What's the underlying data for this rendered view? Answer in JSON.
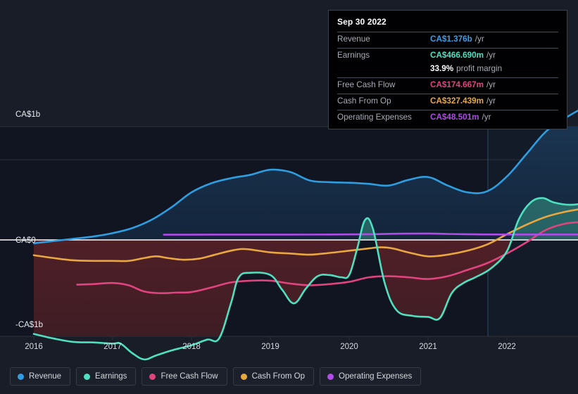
{
  "tooltip": {
    "date": "Sep 30 2022",
    "rows": [
      {
        "key": "Revenue",
        "value": "CA$1.376b",
        "unit": "/yr",
        "color": "#3aa0e8"
      },
      {
        "key": "Earnings",
        "value": "CA$466.690m",
        "unit": "/yr",
        "color": "#4fe0c0"
      },
      {
        "key": "Free Cash Flow",
        "value": "CA$174.667m",
        "unit": "/yr",
        "color": "#e0447f"
      },
      {
        "key": "Cash From Op",
        "value": "CA$327.439m",
        "unit": "/yr",
        "color": "#e9a83f"
      },
      {
        "key": "Operating Expenses",
        "value": "CA$48.501m",
        "unit": "/yr",
        "color": "#b04ae8"
      }
    ],
    "profit_margin_value": "33.9%",
    "profit_margin_label": "profit margin"
  },
  "legend": [
    {
      "label": "Revenue",
      "color": "#2f9ee0"
    },
    {
      "label": "Earnings",
      "color": "#4fe0c0"
    },
    {
      "label": "Free Cash Flow",
      "color": "#e0447f"
    },
    {
      "label": "Cash From Op",
      "color": "#e9a83f"
    },
    {
      "label": "Operating Expenses",
      "color": "#b04ae8"
    }
  ],
  "axes": {
    "y_labels": [
      "CA$1b",
      "CA$0",
      "-CA$1b"
    ],
    "x_labels": [
      "2016",
      "2017",
      "2018",
      "2019",
      "2020",
      "2021",
      "2022"
    ]
  },
  "chart_data": {
    "type": "area",
    "title": "",
    "xlabel": "",
    "ylabel": "CA$",
    "ylim": [
      -1250000000,
      1250000000
    ],
    "y_tick_values": [
      1000000000,
      0,
      -1000000000
    ],
    "y_tick_labels": [
      "CA$1b",
      "CA$0",
      "-CA$1b"
    ],
    "x_tick_labels": [
      "2016",
      "2017",
      "2018",
      "2019",
      "2020",
      "2021",
      "2022"
    ],
    "grid": true,
    "legend_position": "bottom-left",
    "currency": "CA$",
    "forecast_boundary_x_label": "late 2021",
    "series": [
      {
        "name": "Revenue",
        "color": "#2f9ee0",
        "points": [
          [
            2016.0,
            -0.03
          ],
          [
            2016.25,
            -0.01
          ],
          [
            2016.5,
            0.01
          ],
          [
            2016.75,
            0.03
          ],
          [
            2017.0,
            0.06
          ],
          [
            2017.25,
            0.105
          ],
          [
            2017.5,
            0.18
          ],
          [
            2017.75,
            0.29
          ],
          [
            2018.0,
            0.42
          ],
          [
            2018.25,
            0.5
          ],
          [
            2018.5,
            0.545
          ],
          [
            2018.75,
            0.575
          ],
          [
            2019.0,
            0.62
          ],
          [
            2019.25,
            0.6
          ],
          [
            2019.5,
            0.525
          ],
          [
            2019.75,
            0.51
          ],
          [
            2020.0,
            0.505
          ],
          [
            2020.25,
            0.495
          ],
          [
            2020.5,
            0.48
          ],
          [
            2020.75,
            0.53
          ],
          [
            2021.0,
            0.555
          ],
          [
            2021.25,
            0.48
          ],
          [
            2021.5,
            0.42
          ],
          [
            2021.75,
            0.43
          ],
          [
            2022.0,
            0.56
          ],
          [
            2022.25,
            0.76
          ],
          [
            2022.5,
            0.96
          ],
          [
            2022.75,
            1.08
          ],
          [
            2023.0,
            1.18
          ],
          [
            2023.25,
            1.28
          ],
          [
            2023.5,
            1.376
          ]
        ]
      },
      {
        "name": "Earnings",
        "color": "#4fe0c0",
        "points": [
          [
            2016.0,
            -0.83
          ],
          [
            2016.25,
            -0.87
          ],
          [
            2016.5,
            -0.9
          ],
          [
            2016.75,
            -0.905
          ],
          [
            2017.0,
            -0.915
          ],
          [
            2017.1,
            -0.915
          ],
          [
            2017.25,
            -1.0
          ],
          [
            2017.4,
            -1.055
          ],
          [
            2017.55,
            -1.02
          ],
          [
            2017.75,
            -0.975
          ],
          [
            2018.0,
            -0.93
          ],
          [
            2018.2,
            -0.88
          ],
          [
            2018.35,
            -0.87
          ],
          [
            2018.5,
            -0.56
          ],
          [
            2018.6,
            -0.33
          ],
          [
            2018.75,
            -0.29
          ],
          [
            2019.0,
            -0.31
          ],
          [
            2019.15,
            -0.44
          ],
          [
            2019.3,
            -0.56
          ],
          [
            2019.45,
            -0.43
          ],
          [
            2019.6,
            -0.32
          ],
          [
            2019.75,
            -0.31
          ],
          [
            2019.9,
            -0.33
          ],
          [
            2020.0,
            -0.31
          ],
          [
            2020.1,
            -0.08
          ],
          [
            2020.2,
            0.175
          ],
          [
            2020.3,
            0.1
          ],
          [
            2020.45,
            -0.38
          ],
          [
            2020.6,
            -0.62
          ],
          [
            2020.8,
            -0.67
          ],
          [
            2021.0,
            -0.68
          ],
          [
            2021.15,
            -0.69
          ],
          [
            2021.3,
            -0.47
          ],
          [
            2021.45,
            -0.38
          ],
          [
            2021.6,
            -0.33
          ],
          [
            2021.8,
            -0.25
          ],
          [
            2022.0,
            -0.1
          ],
          [
            2022.15,
            0.18
          ],
          [
            2022.3,
            0.33
          ],
          [
            2022.45,
            0.37
          ],
          [
            2022.6,
            0.33
          ],
          [
            2022.8,
            0.31
          ],
          [
            2023.0,
            0.33
          ],
          [
            2023.25,
            0.39
          ],
          [
            2023.5,
            0.467
          ]
        ]
      },
      {
        "name": "Free Cash Flow",
        "color": "#e0447f",
        "points": [
          [
            2016.55,
            -0.395
          ],
          [
            2016.75,
            -0.39
          ],
          [
            2017.0,
            -0.38
          ],
          [
            2017.2,
            -0.4
          ],
          [
            2017.4,
            -0.455
          ],
          [
            2017.6,
            -0.47
          ],
          [
            2017.8,
            -0.465
          ],
          [
            2018.0,
            -0.46
          ],
          [
            2018.25,
            -0.42
          ],
          [
            2018.5,
            -0.375
          ],
          [
            2018.75,
            -0.36
          ],
          [
            2019.0,
            -0.36
          ],
          [
            2019.25,
            -0.385
          ],
          [
            2019.5,
            -0.4
          ],
          [
            2019.75,
            -0.39
          ],
          [
            2020.0,
            -0.37
          ],
          [
            2020.25,
            -0.33
          ],
          [
            2020.5,
            -0.32
          ],
          [
            2020.75,
            -0.33
          ],
          [
            2021.0,
            -0.345
          ],
          [
            2021.25,
            -0.32
          ],
          [
            2021.5,
            -0.265
          ],
          [
            2021.75,
            -0.205
          ],
          [
            2022.0,
            -0.12
          ],
          [
            2022.25,
            -0.02
          ],
          [
            2022.5,
            0.09
          ],
          [
            2022.75,
            0.145
          ],
          [
            2023.0,
            0.16
          ],
          [
            2023.25,
            0.168
          ],
          [
            2023.5,
            0.175
          ]
        ]
      },
      {
        "name": "Cash From Op",
        "color": "#e9a83f",
        "points": [
          [
            2016.0,
            -0.135
          ],
          [
            2016.25,
            -0.16
          ],
          [
            2016.5,
            -0.18
          ],
          [
            2016.75,
            -0.185
          ],
          [
            2017.0,
            -0.185
          ],
          [
            2017.2,
            -0.185
          ],
          [
            2017.4,
            -0.16
          ],
          [
            2017.55,
            -0.145
          ],
          [
            2017.7,
            -0.16
          ],
          [
            2017.9,
            -0.175
          ],
          [
            2018.1,
            -0.165
          ],
          [
            2018.3,
            -0.13
          ],
          [
            2018.5,
            -0.095
          ],
          [
            2018.65,
            -0.08
          ],
          [
            2018.8,
            -0.09
          ],
          [
            2019.0,
            -0.11
          ],
          [
            2019.25,
            -0.12
          ],
          [
            2019.5,
            -0.13
          ],
          [
            2019.75,
            -0.115
          ],
          [
            2020.0,
            -0.095
          ],
          [
            2020.25,
            -0.075
          ],
          [
            2020.4,
            -0.065
          ],
          [
            2020.55,
            -0.075
          ],
          [
            2020.75,
            -0.11
          ],
          [
            2021.0,
            -0.145
          ],
          [
            2021.25,
            -0.13
          ],
          [
            2021.5,
            -0.095
          ],
          [
            2021.75,
            -0.04
          ],
          [
            2022.0,
            0.05
          ],
          [
            2022.25,
            0.135
          ],
          [
            2022.5,
            0.205
          ],
          [
            2022.75,
            0.25
          ],
          [
            2023.0,
            0.28
          ],
          [
            2023.25,
            0.305
          ],
          [
            2023.5,
            0.327
          ]
        ]
      },
      {
        "name": "Operating Expenses",
        "color": "#b04ae8",
        "points": [
          [
            2017.65,
            0.046
          ],
          [
            2017.9,
            0.046
          ],
          [
            2018.25,
            0.047
          ],
          [
            2018.75,
            0.047
          ],
          [
            2019.25,
            0.047
          ],
          [
            2019.75,
            0.048
          ],
          [
            2020.25,
            0.05
          ],
          [
            2020.6,
            0.055
          ],
          [
            2021.0,
            0.056
          ],
          [
            2021.3,
            0.052
          ],
          [
            2021.6,
            0.049
          ],
          [
            2022.0,
            0.048
          ],
          [
            2022.5,
            0.048
          ],
          [
            2023.0,
            0.048
          ],
          [
            2023.5,
            0.0485
          ]
        ]
      }
    ]
  },
  "colors": {
    "background": "#181d27",
    "plot_background": "#101521",
    "forecast_background": "#131a28",
    "grid": "#2b313c",
    "zero_line": "#ffffff",
    "positive_fill": "#16293d",
    "negative_fill": "#4a2026"
  }
}
